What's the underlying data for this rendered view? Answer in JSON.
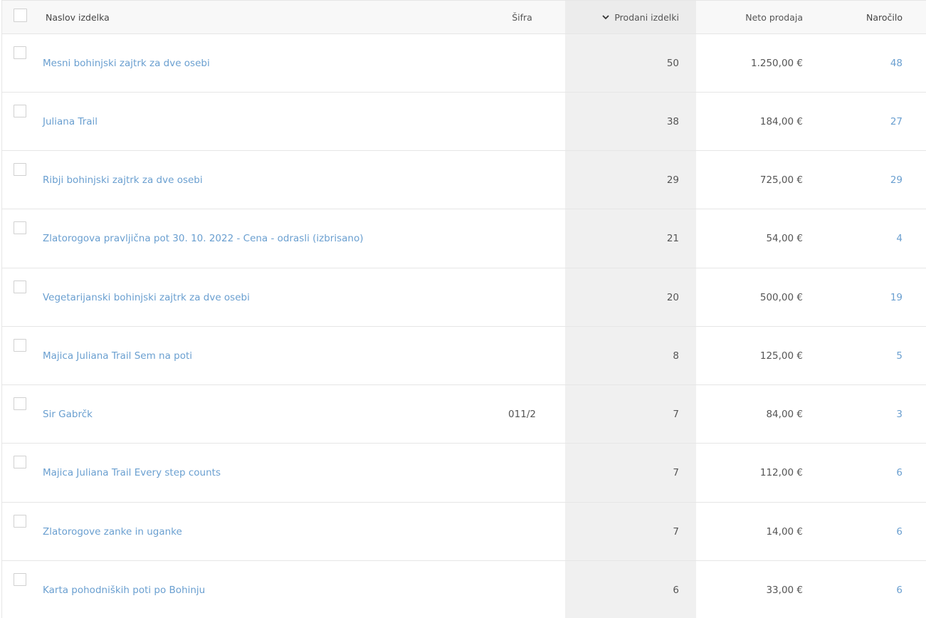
{
  "columns": {
    "title": "Naslov izdelka",
    "sku": "Šifra",
    "sold": "Prodani izdelki",
    "net": "Neto prodaja",
    "orders": "Naročilo"
  },
  "rows": [
    {
      "title": "Mesni bohinjski zajtrk za dve osebi",
      "sku": "",
      "sold": "50",
      "net": "1.250,00 €",
      "orders": "48"
    },
    {
      "title": "Juliana Trail",
      "sku": "",
      "sold": "38",
      "net": "184,00 €",
      "orders": "27"
    },
    {
      "title": "Ribji bohinjski zajtrk za dve osebi",
      "sku": "",
      "sold": "29",
      "net": "725,00 €",
      "orders": "29"
    },
    {
      "title": "Zlatorogova pravljična pot 30. 10. 2022 - Cena - odrasli (izbrisano)",
      "sku": "",
      "sold": "21",
      "net": "54,00 €",
      "orders": "4"
    },
    {
      "title": "Vegetarijanski bohinjski zajtrk za dve osebi",
      "sku": "",
      "sold": "20",
      "net": "500,00 €",
      "orders": "19"
    },
    {
      "title": "Majica Juliana Trail Sem na poti",
      "sku": "",
      "sold": "8",
      "net": "125,00 €",
      "orders": "5"
    },
    {
      "title": "Sir Gabrčk",
      "sku": "011/2",
      "sold": "7",
      "net": "84,00 €",
      "orders": "3"
    },
    {
      "title": "Majica Juliana Trail Every step counts",
      "sku": "",
      "sold": "7",
      "net": "112,00 €",
      "orders": "6"
    },
    {
      "title": "Zlatorogove zanke in uganke",
      "sku": "",
      "sold": "7",
      "net": "14,00 €",
      "orders": "6"
    },
    {
      "title": "Karta pohodniških poti po Bohinju",
      "sku": "",
      "sold": "6",
      "net": "33,00 €",
      "orders": "6"
    }
  ],
  "colors": {
    "link": "#6a9fd0",
    "sorted_column_bg": "#f0f0f0"
  },
  "icons": {
    "sort": "chevron-down-icon"
  }
}
